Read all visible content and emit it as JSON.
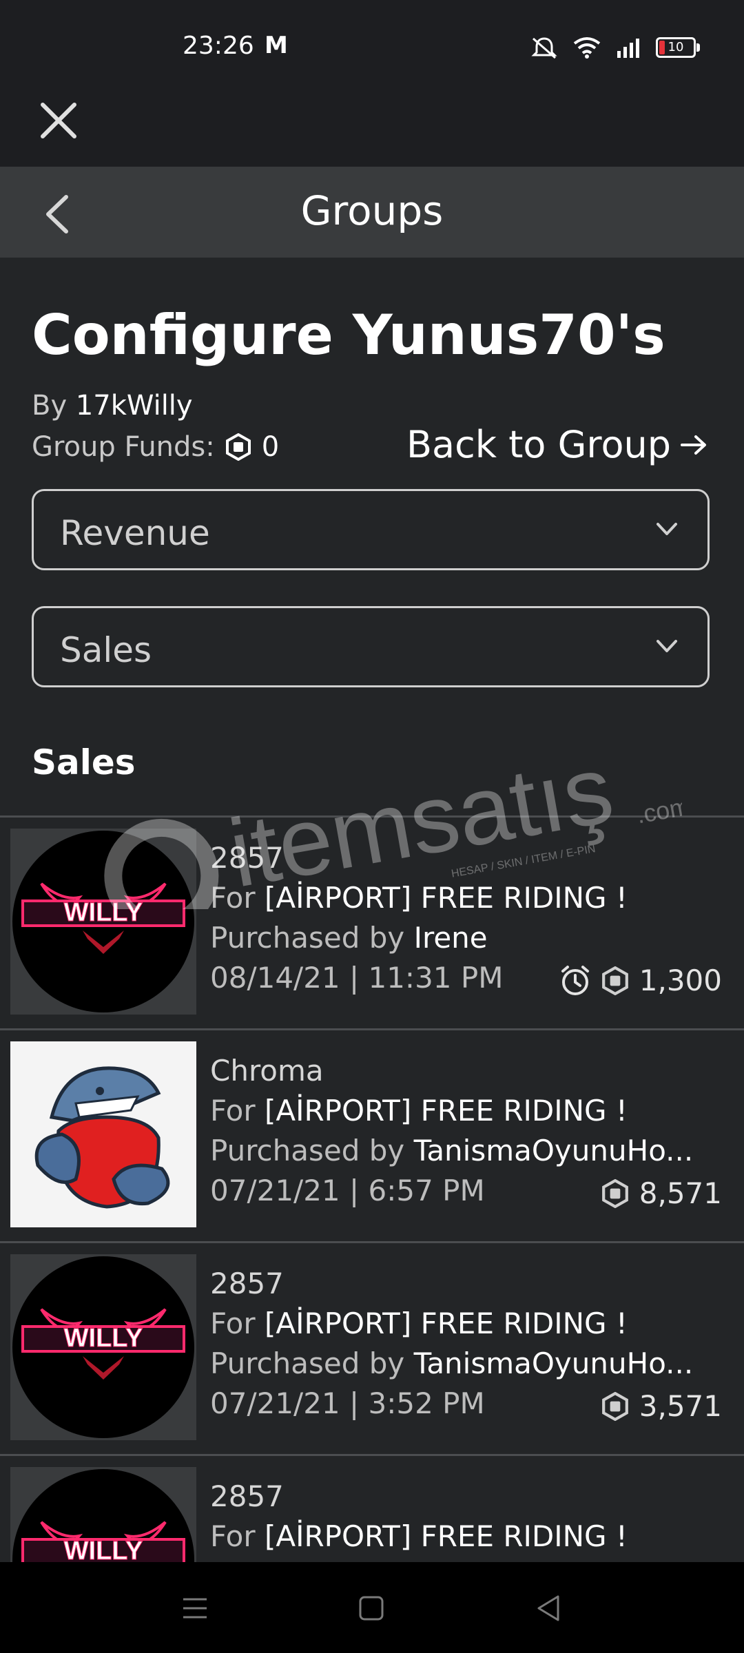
{
  "status_bar": {
    "time": "23:26",
    "carrier_mark": "M",
    "battery_level": "10"
  },
  "header": {
    "title": "Groups"
  },
  "group": {
    "title": "Configure Yunus70's",
    "by_label": "By",
    "owner": "17kWilly",
    "funds_label": "Group Funds:",
    "funds_amount": "0",
    "back_link": "Back to Group"
  },
  "dropdowns": {
    "category": "Revenue",
    "subcategory": "Sales"
  },
  "section_title": "Sales",
  "sales": [
    {
      "name": "2857",
      "for_label": "For",
      "place": "[AİRPORT] FREE RIDING !",
      "purchased_label": "Purchased by",
      "buyer": "Irene",
      "date": "08/14/21 | 11:31 PM",
      "amount": "1,300",
      "pending": true,
      "thumb": "willy-logo"
    },
    {
      "name": "Chroma",
      "for_label": "For",
      "place": "[AİRPORT] FREE RIDING !",
      "purchased_label": "Purchased by",
      "buyer": "TanismaOyunuHo...",
      "date": "07/21/21 | 6:57 PM",
      "amount": "8,571",
      "pending": false,
      "thumb": "shark-mascot"
    },
    {
      "name": "2857",
      "for_label": "For",
      "place": "[AİRPORT] FREE RIDING !",
      "purchased_label": "Purchased by",
      "buyer": "TanismaOyunuHo...",
      "date": "07/21/21 | 3:52 PM",
      "amount": "3,571",
      "pending": false,
      "thumb": "willy-logo"
    },
    {
      "name": "2857",
      "for_label": "For",
      "place": "[AİRPORT] FREE RIDING !",
      "thumb": "willy-logo"
    }
  ],
  "watermark": {
    "brand": "itemsatış",
    "tagline": "HESAP / SKIN / ITEM / E-PIN",
    "domain": ".com"
  },
  "colors": {
    "background": "#232527",
    "header": "#393b3d",
    "statusbar": "#1d1e21",
    "divider": "#4b4d50"
  }
}
